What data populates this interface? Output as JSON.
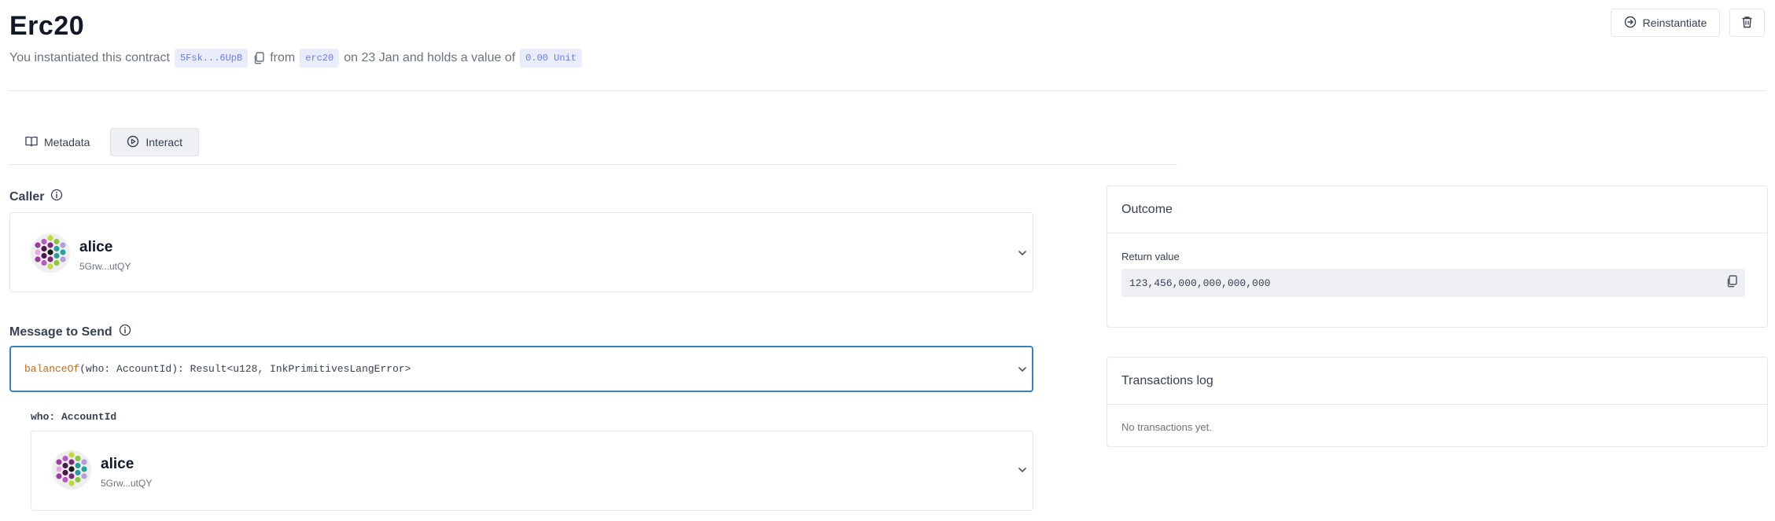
{
  "contract": {
    "title": "Erc20",
    "text_intro": "You instantiated this contract",
    "address_short": "5Fsk...6UpB",
    "text_from": "from",
    "code_name": "erc20",
    "text_on": "on 23 Jan and holds a value of",
    "value": "0.00 Unit"
  },
  "actions": {
    "reinstantiate_label": "Reinstantiate"
  },
  "tabs": [
    {
      "label": "Metadata",
      "icon": "book-icon",
      "active": false
    },
    {
      "label": "Interact",
      "icon": "play-circle-icon",
      "active": true
    }
  ],
  "caller": {
    "label": "Caller",
    "account": {
      "name": "alice",
      "address": "5Grw...utQY"
    }
  },
  "message": {
    "label": "Message to Send",
    "fn_name": "balanceOf",
    "signature_rest": "(who: AccountId): Result<u128, InkPrimitivesLangError>"
  },
  "argument": {
    "label": "who: AccountId",
    "account": {
      "name": "alice",
      "address": "5Grw...utQY"
    }
  },
  "outcome": {
    "title": "Outcome",
    "return_label": "Return value",
    "return_value": "123,456,000,000,000,000"
  },
  "log": {
    "title": "Transactions log",
    "empty_text": "No transactions yet."
  },
  "colors": {
    "accent_border": "#3b82c4",
    "chip_text": "#6b7df0",
    "chip_bg": "#e8ecfb",
    "fn_color": "#c56a17"
  }
}
